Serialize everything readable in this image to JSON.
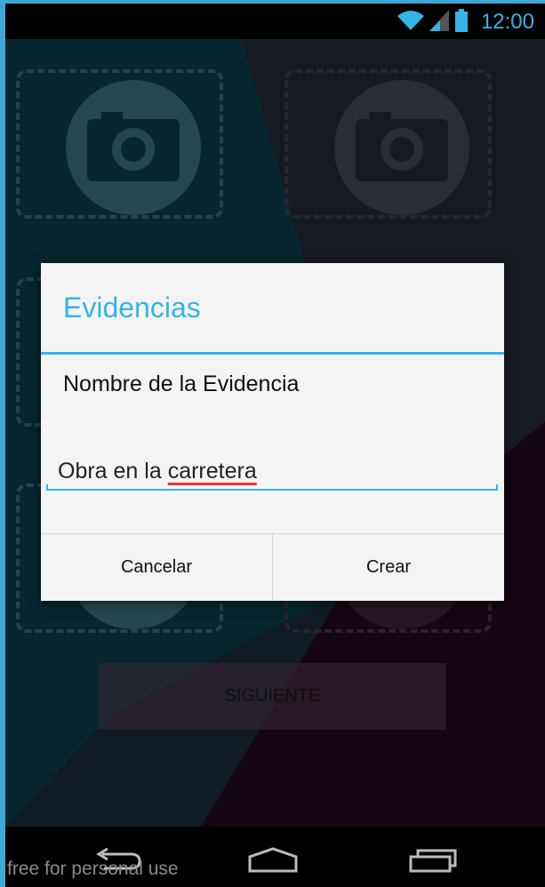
{
  "status_bar": {
    "time": "12:00",
    "icons": [
      "wifi-icon",
      "cell-signal-icon",
      "battery-icon"
    ],
    "accent_color": "#33b5e5"
  },
  "background_app": {
    "photo_slots": [
      {
        "icon": "camera-icon"
      },
      {
        "icon": "camera-icon"
      },
      {
        "icon": "camera-icon"
      },
      {
        "icon": "camera-icon"
      },
      {
        "icon": "camera-icon"
      },
      {
        "icon": "camera-icon"
      }
    ],
    "next_button_label": "SIGUIENTE"
  },
  "dialog": {
    "title": "Evidencias",
    "message": "Nombre de la Evidencia",
    "input_value_prefix": "Obra en la ",
    "input_value_misspelled": "carretera",
    "buttons": {
      "cancel": "Cancelar",
      "create": "Crear"
    }
  },
  "nav_bar": {
    "buttons": [
      "back-icon",
      "home-icon",
      "recent-apps-icon"
    ]
  },
  "watermark": "free for personal use",
  "colors": {
    "accent": "#33b5e5",
    "spellcheck": "#e53935",
    "dialog_bg": "#f4f4f4"
  }
}
